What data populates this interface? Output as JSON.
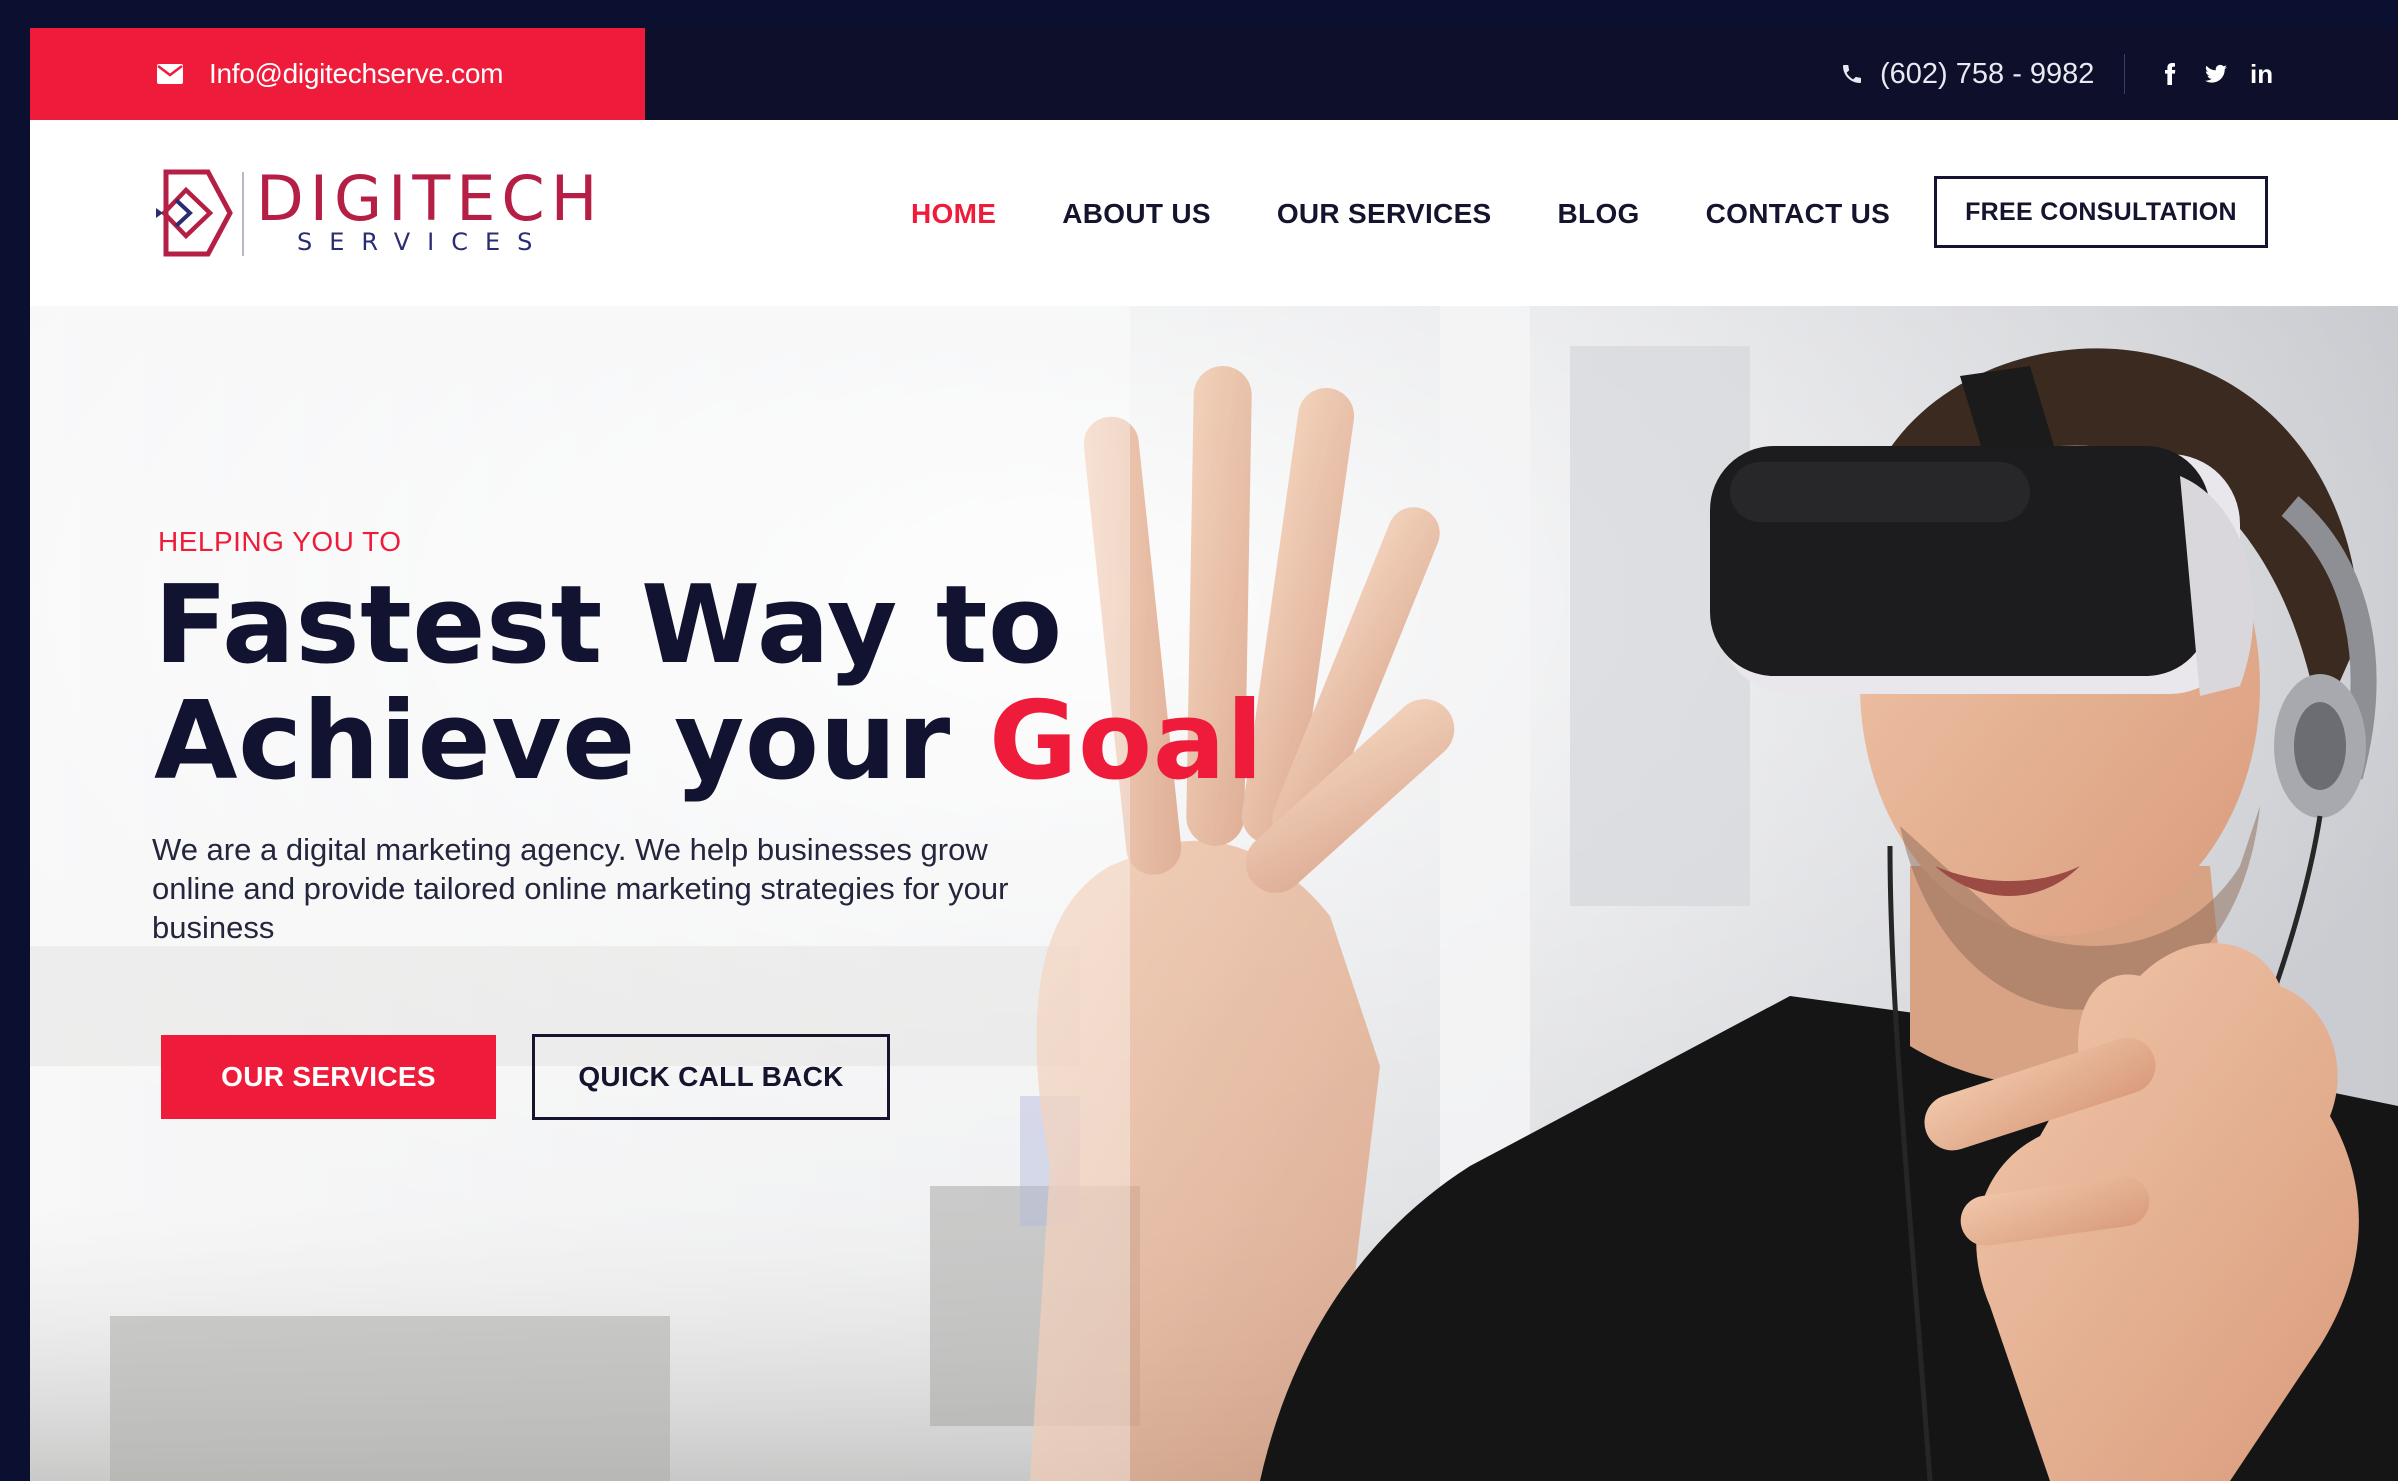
{
  "topbar": {
    "email": "Info@digitechserve.com",
    "phone": "(602) 758 - 9982",
    "socials": [
      {
        "icon": "facebook-icon"
      },
      {
        "icon": "twitter-icon"
      },
      {
        "icon": "linkedin-icon",
        "label": "in"
      }
    ]
  },
  "brand": {
    "name": "DIGITECH",
    "sub": "SERVICES",
    "colors": {
      "accent": "#ee1c3a",
      "navy": "#0d0f2b",
      "logo_red": "#b61f45",
      "logo_blue": "#2b2d73"
    }
  },
  "nav": {
    "items": [
      {
        "label": "HOME",
        "active": true
      },
      {
        "label": "ABOUT US"
      },
      {
        "label": "OUR SERVICES"
      },
      {
        "label": "BLOG"
      },
      {
        "label": "CONTACT US"
      }
    ],
    "cta": "FREE CONSULTATION"
  },
  "hero": {
    "eyebrow": "HELPING YOU TO",
    "title_line1": "Fastest Way to",
    "title_line2": "Achieve your",
    "title_accent": "Goal",
    "description": "We are a digital marketing agency. We help businesses grow online and provide tailored online marketing strategies for your business",
    "primary_button": "OUR SERVICES",
    "secondary_button": "QUICK CALL BACK"
  }
}
